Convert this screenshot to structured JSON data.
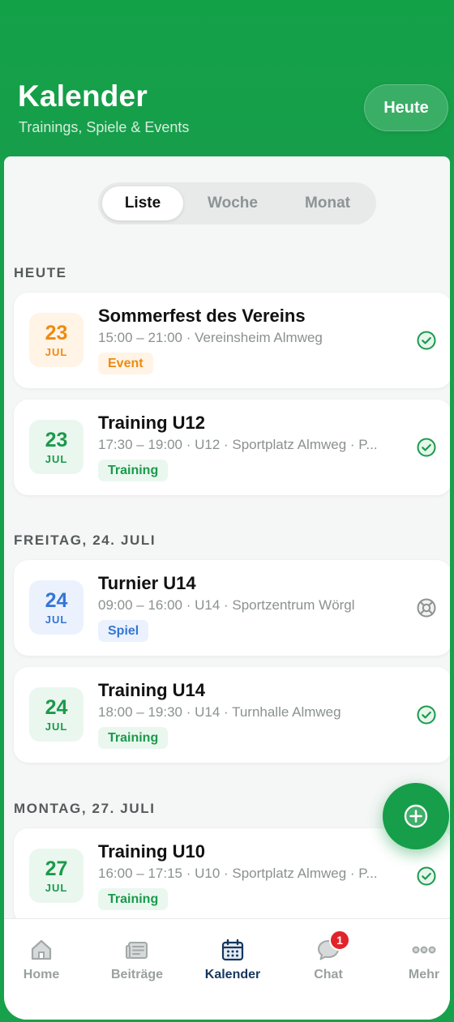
{
  "header": {
    "title": "Kalender",
    "subtitle": "Trainings, Spiele & Events",
    "today_button": "Heute"
  },
  "view_switcher": {
    "options": [
      "Liste",
      "Woche",
      "Monat"
    ],
    "selected": "Liste"
  },
  "sections": [
    {
      "label": "HEUTE",
      "events": [
        {
          "day": "23",
          "month": "JUL",
          "title": "Sommerfest des Vereins",
          "meta": "15:00 – 21:00 · Vereinsheim Almweg",
          "tag": "Event",
          "status": "confirmed"
        },
        {
          "day": "23",
          "month": "JUL",
          "title": "Training U12",
          "meta": "17:30 – 19:00 · U12 · Sportplatz Almweg · P...",
          "tag": "Training",
          "status": "confirmed"
        }
      ]
    },
    {
      "label": "FREITAG, 24. JULI",
      "events": [
        {
          "day": "24",
          "month": "JUL",
          "title": "Turnier U14",
          "meta": "09:00 – 16:00 · U14 · Sportzentrum Wörgl",
          "tag": "Spiel",
          "status": "pending"
        },
        {
          "day": "24",
          "month": "JUL",
          "title": "Training U14",
          "meta": "18:00 – 19:30 · U14 · Turnhalle Almweg",
          "tag": "Training",
          "status": "confirmed"
        }
      ]
    },
    {
      "label": "MONTAG, 27. JULI",
      "events": [
        {
          "day": "27",
          "month": "JUL",
          "title": "Training U10",
          "meta": "16:00 – 17:15 · U10 · Sportplatz Almweg · P...",
          "tag": "Training",
          "status": "confirmed"
        }
      ]
    }
  ],
  "tag_colors": {
    "Event": {
      "bg": "#fff4e6",
      "fg": "#ee8a10"
    },
    "Training": {
      "bg": "#eaf7ef",
      "fg": "#1a9a4b"
    },
    "Spiel": {
      "bg": "#ebf2fd",
      "fg": "#3576d6"
    }
  },
  "fab": {
    "icon": "plus-circle-icon"
  },
  "bottom_nav": {
    "items": [
      {
        "label": "Home",
        "icon": "home-icon"
      },
      {
        "label": "Beiträge",
        "icon": "newspaper-icon"
      },
      {
        "label": "Kalender",
        "icon": "calendar-icon",
        "active": true
      },
      {
        "label": "Chat",
        "icon": "chat-icon",
        "badge": "1"
      },
      {
        "label": "Mehr",
        "icon": "more-icon"
      }
    ]
  },
  "colors": {
    "brand_green": "#179e4a",
    "nav_active": "#16375e",
    "badge_red": "#e3232a"
  }
}
